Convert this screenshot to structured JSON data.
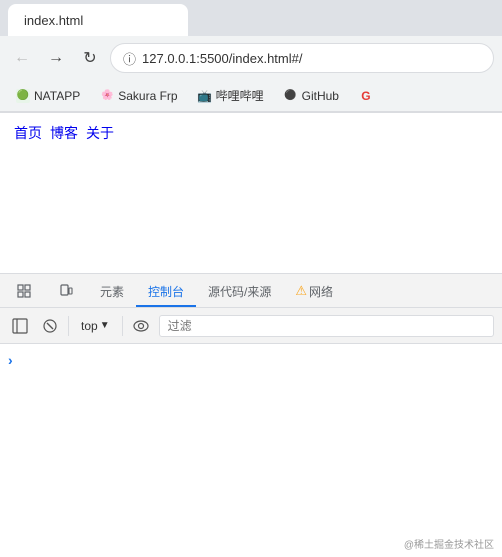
{
  "browser": {
    "tab_title": "index.html",
    "address": "127.0.0.1:5500/index.html#/"
  },
  "bookmarks": [
    {
      "label": "NATAPP",
      "icon": "🟢"
    },
    {
      "label": "Sakura Frp",
      "icon": "🌸"
    },
    {
      "label": "哔哩哔哩",
      "icon": "📺"
    },
    {
      "label": "GitHub",
      "icon": "🐙"
    },
    {
      "label": "G",
      "icon": "🔴"
    }
  ],
  "page": {
    "links": [
      "首页",
      "博客",
      "关于"
    ]
  },
  "devtools": {
    "tabs": [
      {
        "label": "元素",
        "icon": "inspector",
        "active": false
      },
      {
        "label": "控制台",
        "icon": "console",
        "active": true
      },
      {
        "label": "源代码/来源",
        "icon": "sources",
        "active": false
      },
      {
        "label": "网络",
        "icon": "network",
        "active": false,
        "warning": true
      }
    ],
    "toolbar": {
      "top_label": "top",
      "filter_placeholder": "过滤"
    }
  },
  "watermark": "@稀土掘金技术社区"
}
